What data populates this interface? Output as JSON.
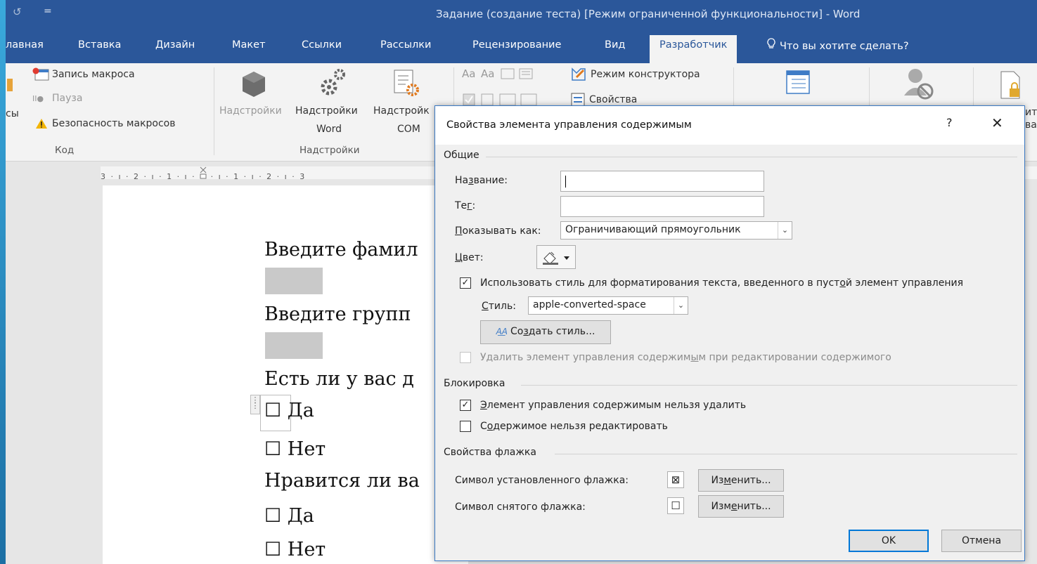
{
  "window": {
    "title": "Задание (создание теста) [Режим ограниченной функциональности] - Word",
    "quick_access_undo": "↺",
    "quick_access_menu": "="
  },
  "tabs": [
    {
      "label": "лавная"
    },
    {
      "label": "Вставка"
    },
    {
      "label": "Дизайн"
    },
    {
      "label": "Макет"
    },
    {
      "label": "Ссылки"
    },
    {
      "label": "Рассылки"
    },
    {
      "label": "Рецензирование"
    },
    {
      "label": "Вид"
    },
    {
      "label": "Разработчик"
    }
  ],
  "tell_me": "Что вы хотите сделать?",
  "ribbon": {
    "code": {
      "record_macro": "Запись макроса",
      "pause": "Пауза",
      "pause_marker": "II●",
      "macros_partial": "сы",
      "macro_security": "Безопасность макросов",
      "group": "Код"
    },
    "addins": {
      "addins": "Надстройки",
      "word_addins_1": "Надстройки",
      "word_addins_2": "Word",
      "com_addins_1": "Надстройк",
      "com_addins_2": "COM",
      "group": "Надстройки"
    },
    "controls": {
      "design_mode": "Режим конструктора",
      "properties": "Свойства",
      "aa1": "Aa",
      "aa2": "Aa"
    },
    "right_partial_1": "ит",
    "right_partial_2": "ва"
  },
  "ruler": {
    "left_text": "3 · ı · 2 · ı · 1 · ı ·",
    "right_text": "· ı · 1 · ı · 2 · ı · 3"
  },
  "document": {
    "line1": "Введите фамил",
    "line2": "Введите групп",
    "line3": "Есть ли у вас д",
    "cb_yes_1": "☐ Да",
    "cb_no_1": "☐ Нет",
    "line4": "Нравится ли ва",
    "cb_yes_2": "☐ Да",
    "cb_no_2": "☐ Нет"
  },
  "dialog": {
    "title": "Свойства элемента управления содержимым",
    "help": "?",
    "close": "✕",
    "general_section": "Общие",
    "name_label_pre": "На",
    "name_label_u": "з",
    "name_label_post": "вание:",
    "name_value": "",
    "tag_label_pre": "Те",
    "tag_label_u": "г",
    "tag_label_post": ":",
    "tag_value": "",
    "show_as_label_u": "П",
    "show_as_label_post": "оказывать как:",
    "show_as_value": "Ограничивающий прямоугольник",
    "color_label_u": "Ц",
    "color_label_post": "вет:",
    "use_style_checked": "✓",
    "use_style_pre": "Использовать стиль для форматирования текста, введенного в пуст",
    "use_style_u": "о",
    "use_style_post": "й элемент управления",
    "style_label_u": "С",
    "style_label_post": "тиль:",
    "style_value": "apple-converted-space",
    "new_style_icon": "A͟A",
    "new_style_pre": "Со",
    "new_style_u": "з",
    "new_style_post": "дать стиль...",
    "remove_on_edit_pre": "Удалить элемент управления содержим",
    "remove_on_edit_u": "ы",
    "remove_on_edit_post": "м при редактировании содержимого",
    "locking_section": "Блокировка",
    "cannot_delete_checked": "✓",
    "cannot_delete_u": "Э",
    "cannot_delete_post": "лемент управления содержимым нельзя удалить",
    "cannot_edit_pre": "С",
    "cannot_edit_u": "о",
    "cannot_edit_post": "держимое нельзя редактировать",
    "checkbox_section": "Свойства флажка",
    "checked_symbol_label": "Символ установленного флажка:",
    "checked_symbol": "⊠",
    "unchecked_symbol_label": "Символ снятого флажка:",
    "unchecked_symbol": "☐",
    "change_pre": "Из",
    "change_u": "м",
    "change_post": "енить...",
    "change2_pre": "Изм",
    "change2_u": "е",
    "change2_post": "нить...",
    "ok": "OK",
    "cancel": "Отмена"
  },
  "colors": {
    "title_bar": "#2b579a",
    "ribbon": "#f3f3f3",
    "dialog_bg": "#f0f0f0",
    "ok_border": "#0078d7"
  }
}
